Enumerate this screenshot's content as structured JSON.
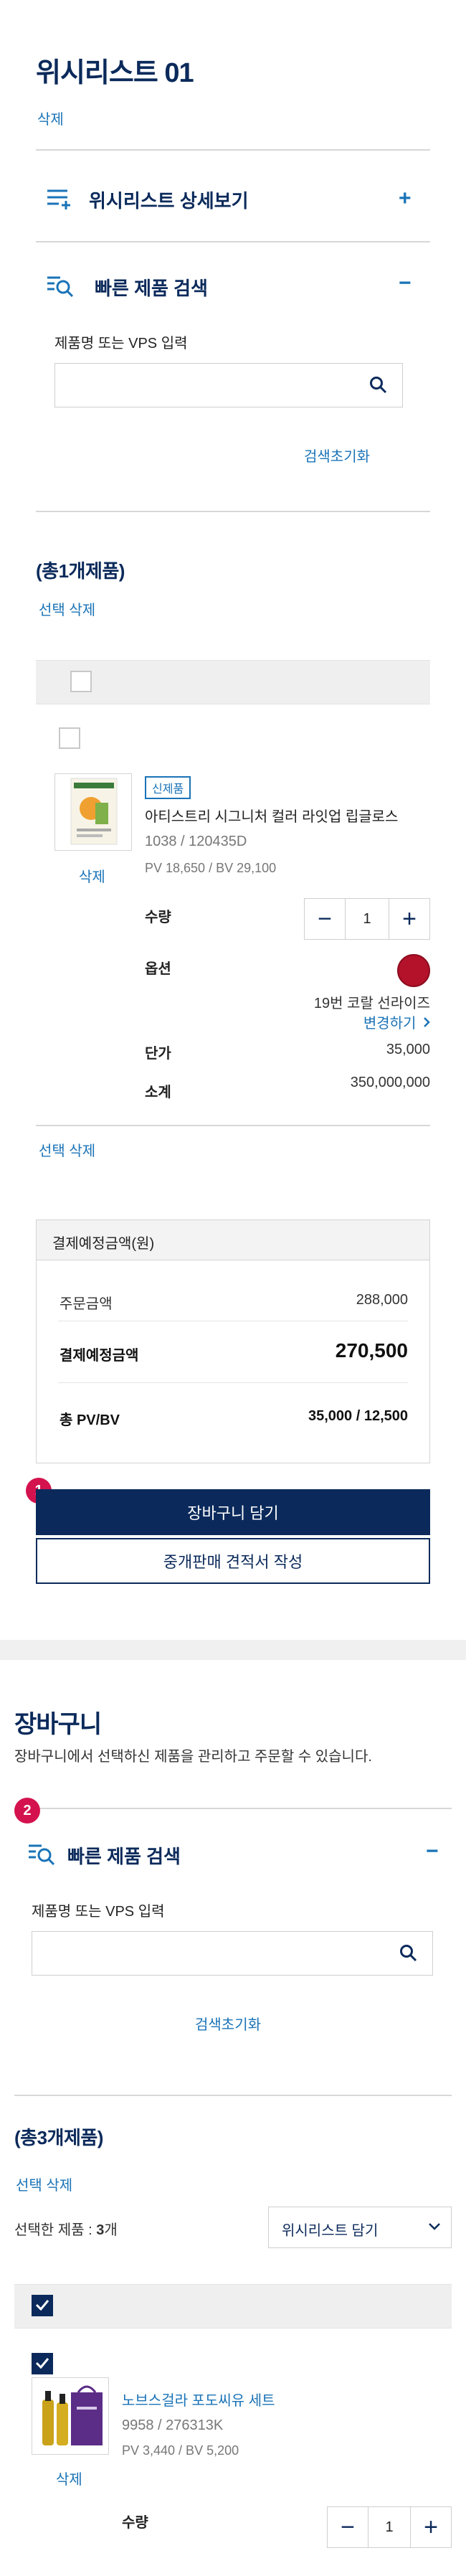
{
  "wishlist": {
    "title": "위시리스트 01",
    "delete_link": "삭제",
    "detail_section": "위시리스트 상세보기",
    "detail_toggle": "+",
    "quick_search": {
      "title": "빠른 제품 검색",
      "toggle": "−",
      "label": "제품명 또는 VPS 입력",
      "placeholder": "",
      "reset": "검색초기화"
    },
    "total_count": "(총1개제품)",
    "select_delete": "선택 삭제",
    "item": {
      "badge": "신제품",
      "name": "아티스트리 시그니처 컬러 라잇업 립글로스",
      "code": "1038 / 120435D",
      "pvbv": "PV 18,650 / BV 29,100",
      "delete": "삭제",
      "qty_label": "수량",
      "qty_minus": "−",
      "qty_value": "1",
      "qty_plus": "+",
      "option_label": "옵션",
      "option_color": "#b3122a",
      "option_name": "19번 코랄 선라이즈",
      "option_change": "변경하기",
      "unit_label": "단가",
      "unit_value": "35,000",
      "subtotal_label": "소계",
      "subtotal_value": "350,000,000"
    },
    "select_delete_bottom": "선택 삭제",
    "summary": {
      "header": "결제예정금액(원)",
      "order_label": "주문금액",
      "order_value": "288,000",
      "pay_label": "결제예정금액",
      "pay_value": "270,500",
      "pvbv_label": "총 PV/BV",
      "pvbv_value": "35,000 / 12,500"
    },
    "step_badge": "1",
    "add_cart_button": "장바구니 담기",
    "quote_button": "중개판매 견적서 작성"
  },
  "cart": {
    "title": "장바구니",
    "subtitle": "장바구니에서 선택하신 제품을 관리하고 주문할 수 있습니다.",
    "step_badge": "2",
    "quick_search": {
      "title": "빠른 제품 검색",
      "toggle": "−",
      "label": "제품명 또는 VPS 입력",
      "placeholder": "",
      "reset": "검색초기화"
    },
    "total_count": "(총3개제품)",
    "select_delete": "선택 삭제",
    "selected_prefix": "선택한 제품 : ",
    "selected_count": "3",
    "selected_suffix": "개",
    "wishlist_select": "위시리스트 담기",
    "item": {
      "name": "노브스걸라 포도씨유 세트",
      "code": "9958 / 276313K",
      "pvbv": "PV 3,440 / BV 5,200",
      "delete": "삭제",
      "qty_label": "수량",
      "qty_minus": "−",
      "qty_value": "1",
      "qty_plus": "+"
    }
  },
  "colors": {
    "navy": "#0b2a5b",
    "link_blue": "#1a73b7",
    "badge_red": "#d4124e"
  },
  "icons": [
    "list-icon",
    "search-product-icon",
    "search-icon",
    "checkbox-icon",
    "chevron-right-icon",
    "chevron-down-icon"
  ]
}
